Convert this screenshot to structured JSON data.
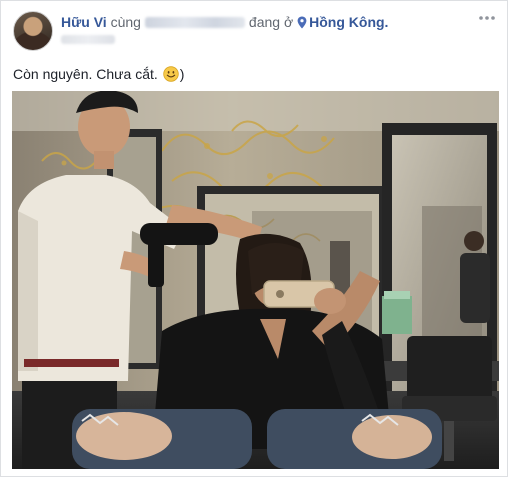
{
  "post": {
    "author_name": "Hữu Vi",
    "with_word": "cùng",
    "location_prefix": "đang ở",
    "location_name": "Hồng Kông.",
    "location_suffix": "",
    "caption_text": "Còn nguyên. Chưa cắt.",
    "caption_end": ")"
  },
  "icons": {
    "avatar": "profile-avatar",
    "location": "map-pin-icon",
    "more": "more-options-icon",
    "emoji": "smile-emoji-icon"
  },
  "colors": {
    "link": "#365899",
    "text": "#1d2129",
    "meta": "#616770"
  }
}
